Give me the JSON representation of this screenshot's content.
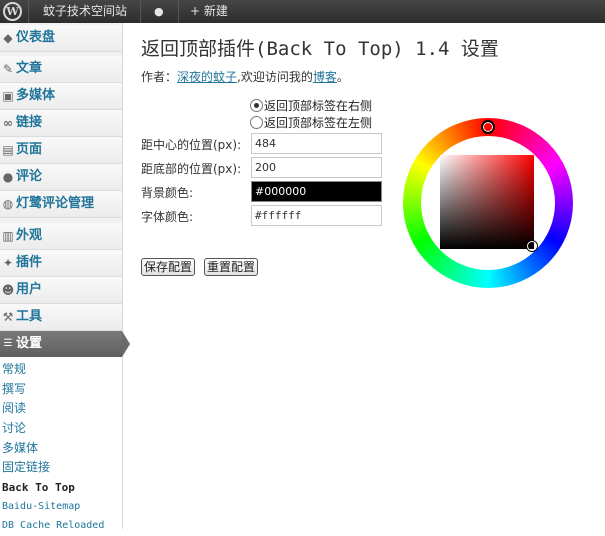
{
  "admin_bar": {
    "logo_glyph": "W",
    "site_name": "蚊子技术空间站",
    "comments_glyph": "●",
    "new_label": "+ 新建"
  },
  "sidebar": {
    "items": [
      {
        "label": "仪表盘",
        "icon": "dashboard-icon",
        "glyph": "◆"
      },
      {
        "label": "文章",
        "icon": "pin-icon",
        "glyph": "✎"
      },
      {
        "label": "多媒体",
        "icon": "media-icon",
        "glyph": "▣"
      },
      {
        "label": "链接",
        "icon": "link-icon",
        "glyph": "∞"
      },
      {
        "label": "页面",
        "icon": "page-icon",
        "glyph": "▤"
      },
      {
        "label": "评论",
        "icon": "comments-icon",
        "glyph": "●"
      },
      {
        "label": "灯鹭评论管理",
        "icon": "plugin-menu-icon",
        "glyph": "◍"
      },
      {
        "label": "外观",
        "icon": "appearance-icon",
        "glyph": "▥"
      },
      {
        "label": "插件",
        "icon": "plugins-icon",
        "glyph": "✦"
      },
      {
        "label": "用户",
        "icon": "users-icon",
        "glyph": "☻"
      },
      {
        "label": "工具",
        "icon": "tools-icon",
        "glyph": "⚒"
      }
    ],
    "settings_label": "设置",
    "settings_glyph": "☰",
    "submenu": [
      "常规",
      "撰写",
      "阅读",
      "讨论",
      "多媒体",
      "固定链接",
      "Back To Top",
      "Baidu-Sitemap",
      "DB Cache Reloaded"
    ]
  },
  "page": {
    "title": "返回顶部插件(Back To Top) 1.4 设置",
    "author_prefix": "作者：",
    "author_name": "深夜的蚊子",
    "author_middle": ",欢迎访问我的",
    "blog_link": "博客",
    "author_suffix": "。",
    "radio_right": "返回顶部标签在右侧",
    "radio_left": "返回顶部标签在左侧",
    "radio_selected": "right",
    "center_label": "距中心的位置(px):",
    "center_value": "484",
    "bottom_label": "距底部的位置(px):",
    "bottom_value": "200",
    "bg_label": "背景颜色:",
    "bg_value": "#000000",
    "font_label": "字体颜色:",
    "font_value": "#ffffff",
    "save_button": "保存配置",
    "reset_button": "重置配置"
  },
  "colors": {
    "adminbar": "#464646",
    "link": "#21759b",
    "selected_background": "#000000",
    "selected_font": "#ffffff"
  }
}
